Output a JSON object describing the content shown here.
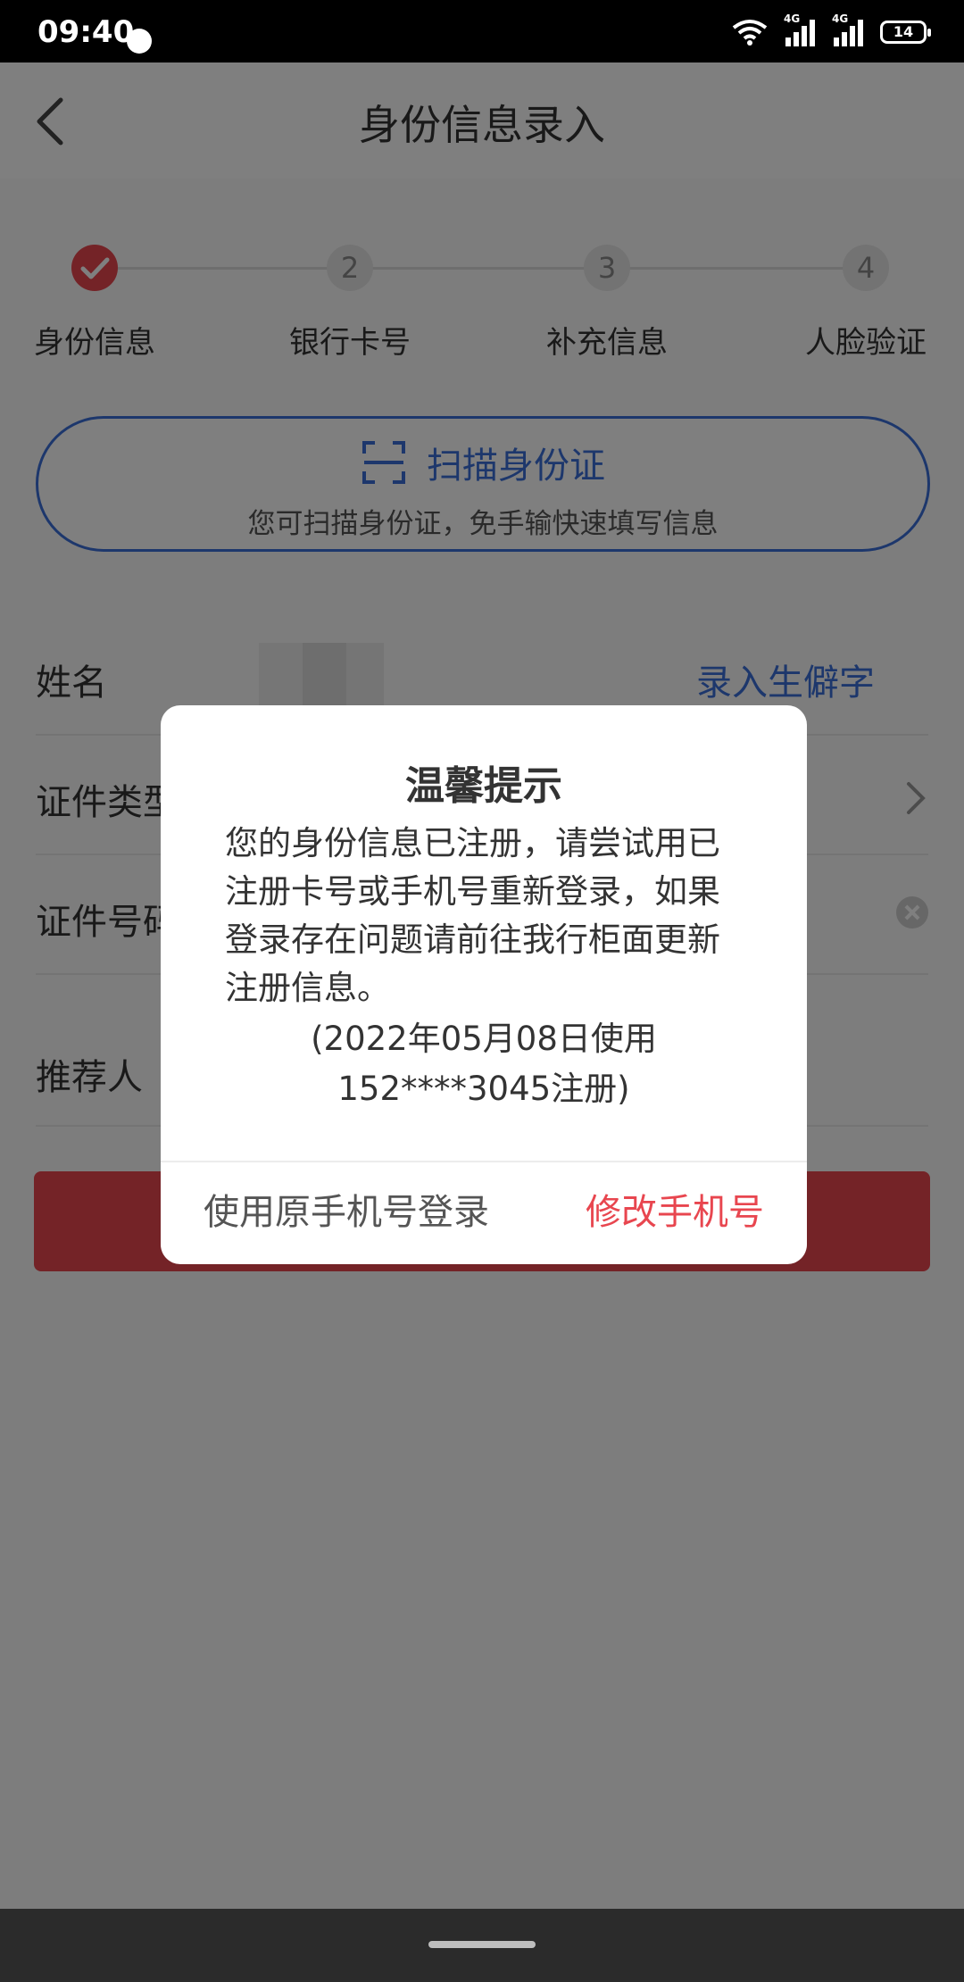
{
  "status_bar": {
    "time": "09:40",
    "signal_label_1": "4G",
    "signal_label_2": "4G",
    "battery": "14"
  },
  "header": {
    "title": "身份信息录入"
  },
  "steps": [
    {
      "label": "身份信息",
      "number": "",
      "done": true
    },
    {
      "label": "银行卡号",
      "number": "2"
    },
    {
      "label": "补充信息",
      "number": "3"
    },
    {
      "label": "人脸验证",
      "number": "4"
    }
  ],
  "scan": {
    "title": "扫描身份证",
    "subtitle": "您可扫描身份证，免手输快速填写信息"
  },
  "form": {
    "name_label": "姓名",
    "rare_char_link": "录入生僻字",
    "id_type_label": "证件类型",
    "id_number_label": "证件号码",
    "referrer_label": "推荐人"
  },
  "dialog": {
    "title": "温馨提示",
    "message": "您的身份信息已注册，请尝试用已注册卡号或手机号重新登录，如果登录存在问题请前往我行柜面更新注册信息。",
    "note_line1": "(2022年05月08日使用",
    "note_line2": "152****3045注册)",
    "left_button": "使用原手机号登录",
    "right_button": "修改手机号"
  },
  "colors": {
    "accent_blue": "#3a6fd8",
    "accent_red": "#e8464f"
  }
}
